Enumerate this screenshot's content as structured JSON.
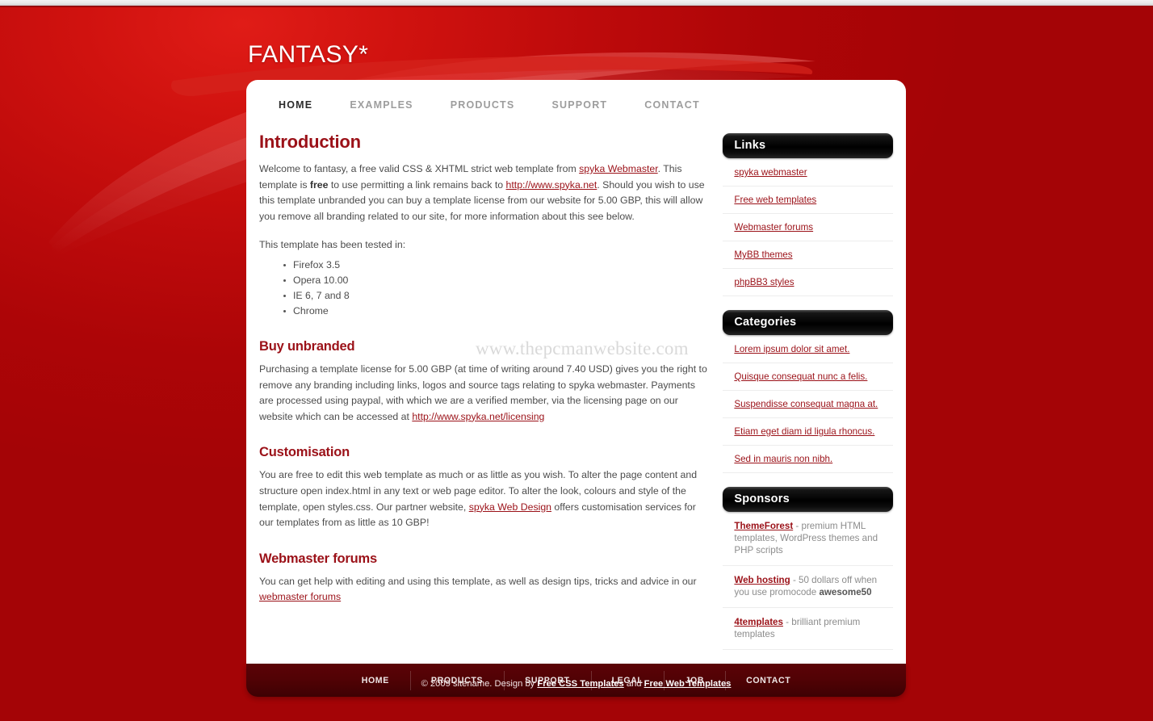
{
  "site": {
    "logo": "FANTASY*",
    "watermark": "www.thepcmanwebsite.com",
    "accent_color": "#9b1118",
    "background_color": "#ae0508",
    "footer_bar_color": "#520205"
  },
  "mainnav": {
    "items": [
      {
        "label": "HOME",
        "active": true
      },
      {
        "label": "EXAMPLES",
        "active": false
      },
      {
        "label": "PRODUCTS",
        "active": false
      },
      {
        "label": "SUPPORT",
        "active": false
      },
      {
        "label": "CONTACT",
        "active": false
      }
    ]
  },
  "main": {
    "intro": {
      "heading": "Introduction",
      "para1_a": "Welcome to fantasy, a free valid CSS & XHTML strict web template from ",
      "para1_link1": "spyka Webmaster",
      "para1_b": ". This template is ",
      "para1_strong": "free",
      "para1_c": " to use permitting a link remains back to ",
      "para1_link2": "http://www.spyka.net",
      "para1_d": ". Should you wish to use this template unbranded you can buy a template license from our website for 5.00 GBP, this will allow you remove all branding related to our site, for more information about this see below.",
      "para2": "This template has been tested in:",
      "browsers": [
        "Firefox 3.5",
        "Opera 10.00",
        "IE 6, 7 and 8",
        "Chrome"
      ]
    },
    "buy": {
      "heading": "Buy unbranded",
      "para_a": "Purchasing a template license for 5.00 GBP (at time of writing around 7.40 USD) gives you the right to remove any branding including links, logos and source tags relating to spyka webmaster. Payments are processed using paypal, with which we are a verified member, via the licensing page on our website which can be accessed at ",
      "para_link": "http://www.spyka.net/licensing"
    },
    "customisation": {
      "heading": "Customisation",
      "para_a": "You are free to edit this web template as much or as little as you wish. To alter the page content and structure open index.html in any text or web page editor. To alter the look, colours and style of the template, open styles.css. Our partner website, ",
      "para_link": "spyka Web Design",
      "para_b": " offers customisation services for our templates from as little as 10 GBP!"
    },
    "forums": {
      "heading": "Webmaster forums",
      "para_a": "You can get help with editing and using this template, as well as design tips, tricks and advice in our ",
      "para_link": "webmaster forums"
    }
  },
  "sidebar": {
    "links": {
      "title": "Links",
      "items": [
        "spyka webmaster",
        "Free web templates",
        "Webmaster forums",
        "MyBB themes",
        "phpBB3 styles"
      ]
    },
    "categories": {
      "title": "Categories",
      "items": [
        "Lorem ipsum dolor sit amet.",
        "Quisque consequat nunc a felis.",
        "Suspendisse consequat magna at.",
        "Etiam eget diam id ligula rhoncus.",
        "Sed in mauris non nibh."
      ]
    },
    "sponsors": {
      "title": "Sponsors",
      "items": [
        {
          "link": "ThemeForest",
          "desc_a": " - premium HTML templates, WordPress themes and PHP scripts",
          "code": "",
          "desc_b": ""
        },
        {
          "link": "Web hosting",
          "desc_a": " - 50 dollars off when you use promocode ",
          "code": "awesome50",
          "desc_b": ""
        },
        {
          "link": "4templates",
          "desc_a": " - brilliant premium templates",
          "code": "",
          "desc_b": ""
        }
      ]
    }
  },
  "footer": {
    "nav": [
      "HOME",
      "PRODUCTS",
      "SUPPORT",
      "LEGAL",
      "JOB",
      "CONTACT"
    ],
    "copyright_a": "© 2009 sitename. Design by ",
    "copyright_link1": "Free CSS Templates",
    "copyright_b": " and ",
    "copyright_link2": "Free Web Templates"
  }
}
